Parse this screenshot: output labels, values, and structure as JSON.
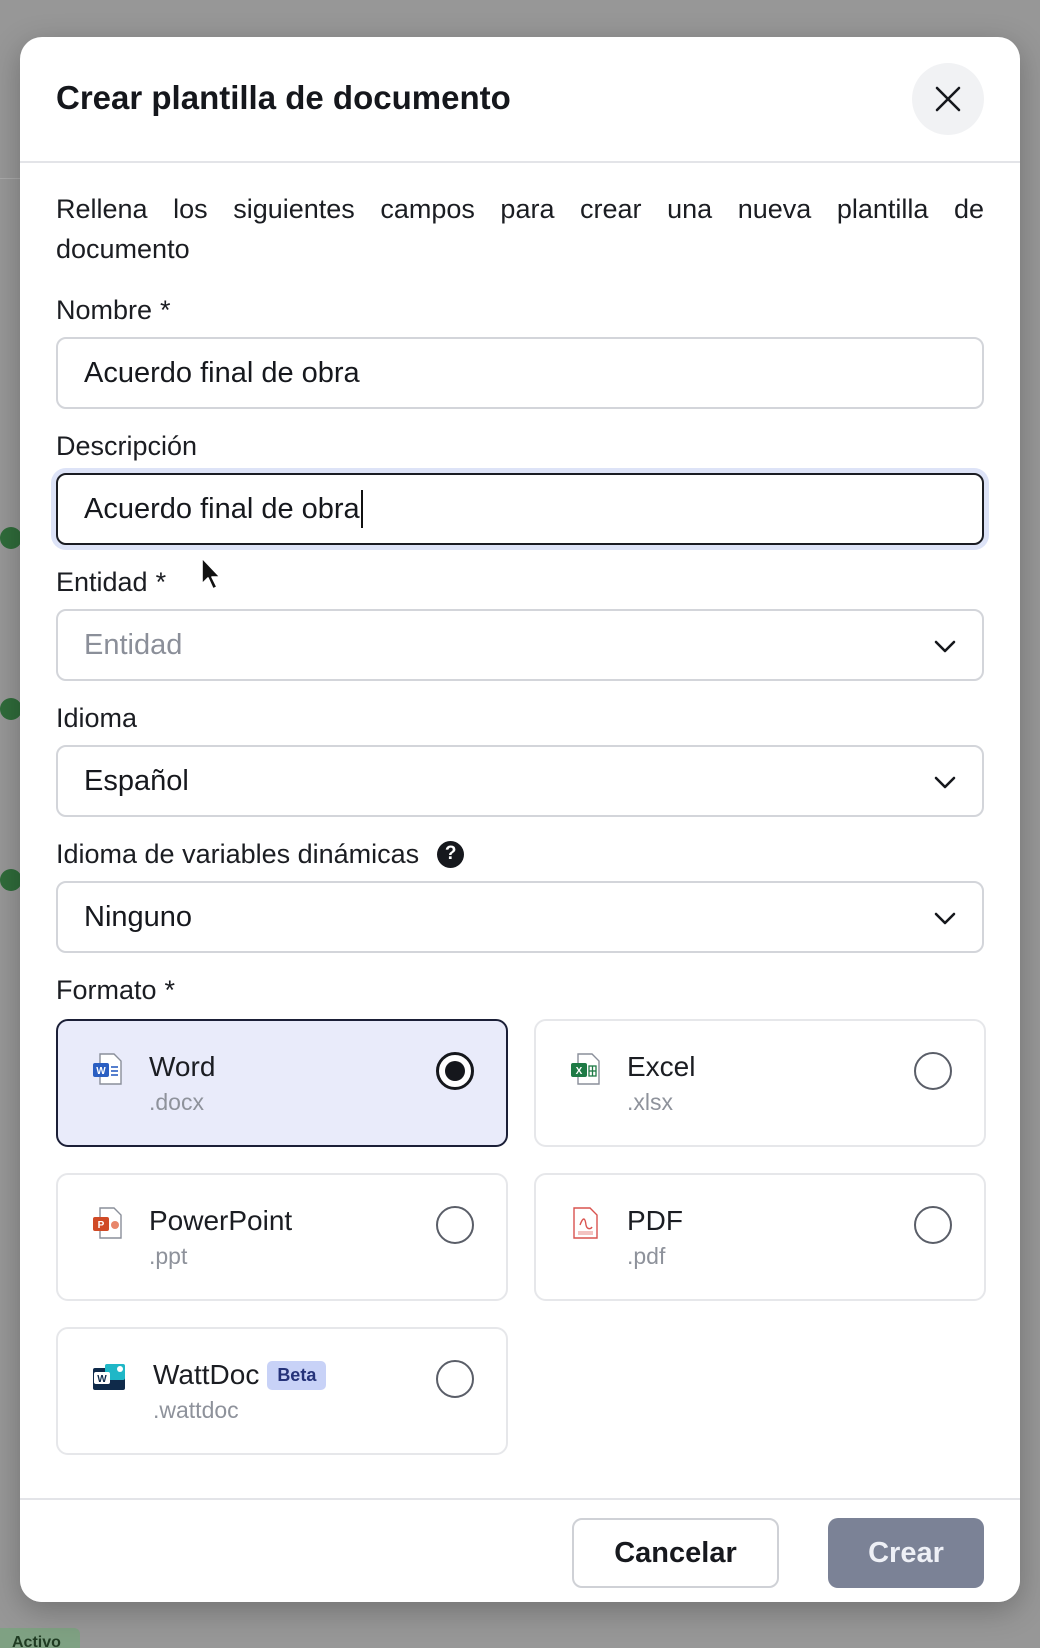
{
  "modal": {
    "title": "Crear plantilla de documento",
    "intro": "Rellena los siguientes campos para crear una nueva plantilla de documento"
  },
  "fields": {
    "nombre": {
      "label": "Nombre",
      "required_mark": "*",
      "value": "Acuerdo final de obra"
    },
    "descripcion": {
      "label": "Descripción",
      "value": "Acuerdo final de obra"
    },
    "entidad": {
      "label": "Entidad",
      "required_mark": "*",
      "placeholder": "Entidad"
    },
    "idioma": {
      "label": "Idioma",
      "value": "Español"
    },
    "idioma_variables": {
      "label": "Idioma de variables dinámicas",
      "help_icon": "?",
      "value": "Ninguno"
    },
    "formato": {
      "label": "Formato",
      "required_mark": "*"
    }
  },
  "formats": [
    {
      "name": "Word",
      "ext": ".docx",
      "selected": true,
      "icon": "word-file-icon"
    },
    {
      "name": "Excel",
      "ext": ".xlsx",
      "selected": false,
      "icon": "excel-file-icon"
    },
    {
      "name": "PowerPoint",
      "ext": ".ppt",
      "selected": false,
      "icon": "powerpoint-file-icon"
    },
    {
      "name": "PDF",
      "ext": ".pdf",
      "selected": false,
      "icon": "pdf-file-icon"
    },
    {
      "name": "WattDoc",
      "ext": ".wattdoc",
      "badge": "Beta",
      "selected": false,
      "icon": "wattdoc-file-icon"
    }
  ],
  "footer": {
    "cancel_label": "Cancelar",
    "create_label": "Crear"
  },
  "background": {
    "badge_label": "Activo"
  },
  "colors": {
    "selected_card_bg": "#e9ebfa",
    "create_button_bg": "#7b8296",
    "beta_badge_bg": "#c8d2f7"
  }
}
